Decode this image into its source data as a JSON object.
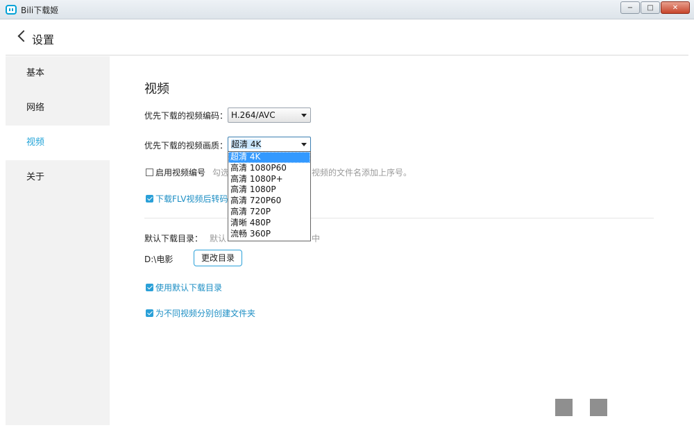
{
  "window": {
    "title": "Bili下载姬",
    "minimize": "−",
    "maximize": "□",
    "close": "✕"
  },
  "header": {
    "title": "设置"
  },
  "sidebar": {
    "items": [
      {
        "label": "基本"
      },
      {
        "label": "网络"
      },
      {
        "label": "视频"
      },
      {
        "label": "关于"
      }
    ],
    "active_index": 2
  },
  "main": {
    "section_title": "视频",
    "codec": {
      "label": "优先下载的视频编码：",
      "value": "H.264/AVC"
    },
    "quality": {
      "label": "优先下载的视频画质：",
      "value": "超清 4K",
      "options": [
        "超清 4K",
        "高清 1080P60",
        "高清 1080P+",
        "高清 1080P",
        "高清 720P60",
        "高清 720P",
        "清晰 480P",
        "流畅 360P"
      ]
    },
    "enable_numbering": {
      "label": "启用视频编号",
      "checked": false,
      "hint": "勾选",
      "hint_tail": "视频的文件名添加上序号。"
    },
    "flv_convert": {
      "label": "下载FLV视频后转码",
      "checked": true
    },
    "default_dir": {
      "label": "默认下载目录：",
      "hint": "默认",
      "hint_tail": "中",
      "path": "D:\\电影",
      "change_button": "更改目录"
    },
    "use_default_dir": {
      "label": "使用默认下载目录",
      "checked": true
    },
    "create_folder": {
      "label": "为不同视频分别创建文件夹",
      "checked": true
    }
  }
}
